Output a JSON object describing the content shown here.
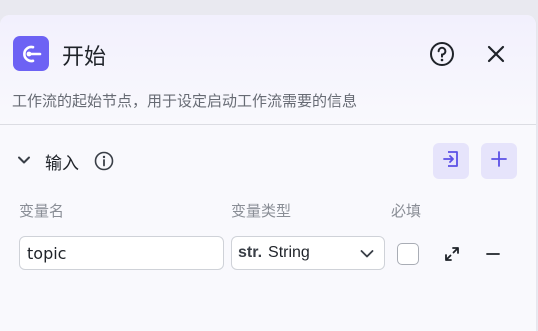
{
  "node": {
    "title": "开始",
    "description": "工作流的起始节点，用于设定启动工作流需要的信息",
    "icon": "start-node-icon"
  },
  "header_actions": {
    "help_icon": "help-circle-icon",
    "close_icon": "close-icon"
  },
  "input_section": {
    "title": "输入",
    "info_icon": "info-circle-icon",
    "actions": [
      "import-icon",
      "plus-icon"
    ],
    "columns": {
      "name": "变量名",
      "type": "变量类型",
      "required": "必填"
    },
    "rows": [
      {
        "name": "topic",
        "type_icon": "str.",
        "type": "String",
        "required": false
      }
    ]
  },
  "colors": {
    "accent": "#6d62f4",
    "accent_light": "#e6e4fb"
  }
}
